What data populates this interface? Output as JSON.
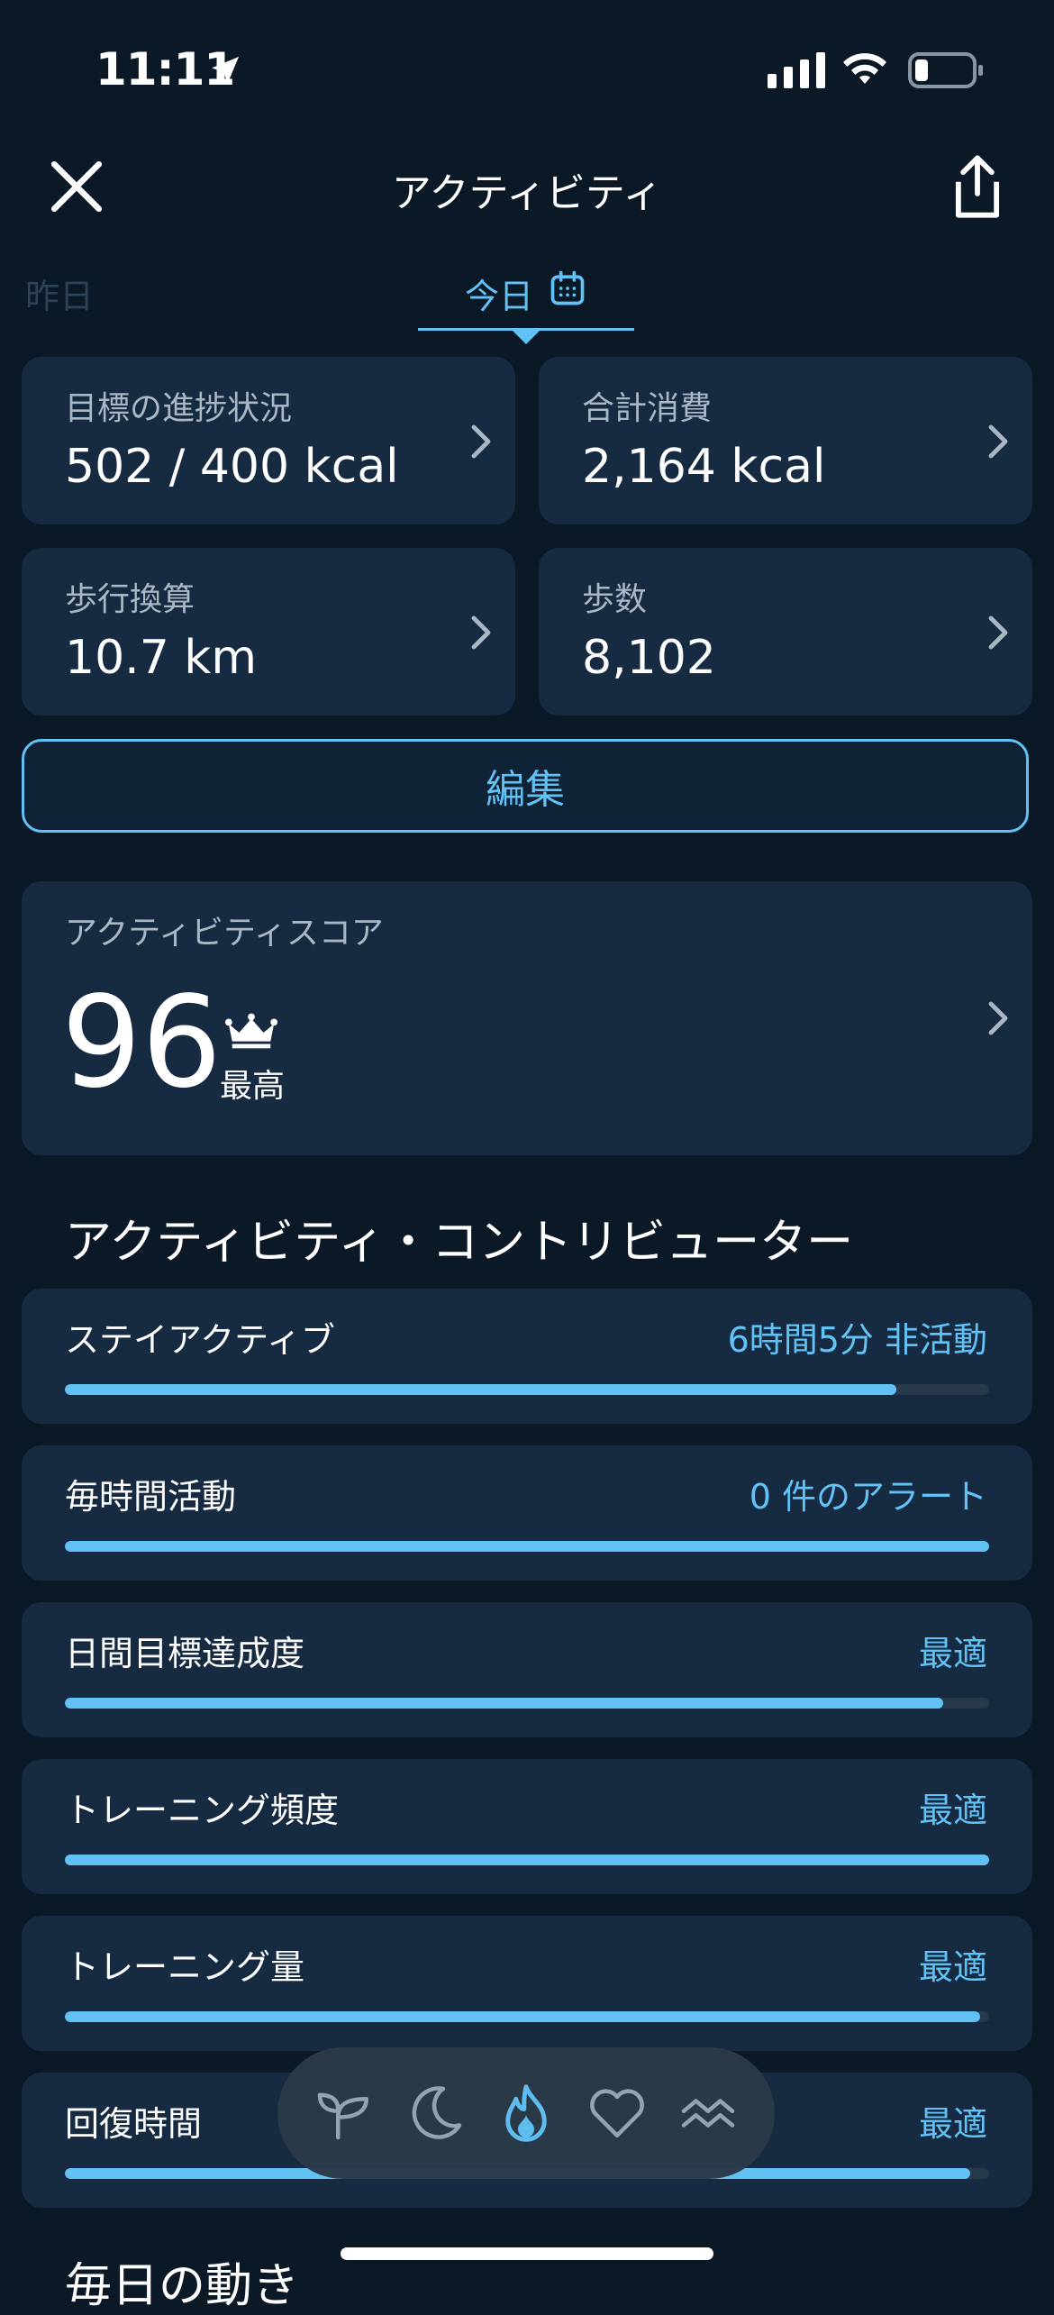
{
  "status_bar": {
    "time": "11:11"
  },
  "header": {
    "title": "アクティビティ"
  },
  "tabs": {
    "yesterday": "昨日",
    "today": "今日"
  },
  "metrics": [
    {
      "label": "目標の進捗状況",
      "value": "502 / 400 kcal"
    },
    {
      "label": "合計消費",
      "value": "2,164 kcal"
    },
    {
      "label": "歩行換算",
      "value": "10.7 km"
    },
    {
      "label": "歩数",
      "value": "8,102"
    }
  ],
  "edit_button": "編集",
  "score": {
    "label": "アクティビティスコア",
    "value": "96",
    "level": "最高"
  },
  "contributors_title": "アクティビティ・コントリビューター",
  "contributors": [
    {
      "label": "ステイアクティブ",
      "status": "6時間5分 非活動",
      "progress": 0.9
    },
    {
      "label": "毎時間活動",
      "status": "0 件のアラート",
      "progress": 1.0
    },
    {
      "label": "日間目標達成度",
      "status": "最適",
      "progress": 0.95
    },
    {
      "label": "トレーニング頻度",
      "status": "最適",
      "progress": 1.0
    },
    {
      "label": "トレーニング量",
      "status": "最適",
      "progress": 0.99
    },
    {
      "label": "回復時間",
      "status": "最適",
      "progress": 0.98
    }
  ],
  "bottom_section_title": "毎日の動き",
  "nav": {
    "items": [
      "sprout-icon",
      "moon-icon",
      "flame-icon",
      "heart-icon",
      "waves-icon"
    ],
    "active": "flame-icon"
  },
  "colors": {
    "background": "#0b1826",
    "card": "#162b42",
    "accent": "#62c1f5",
    "muted": "#aab7c4"
  }
}
